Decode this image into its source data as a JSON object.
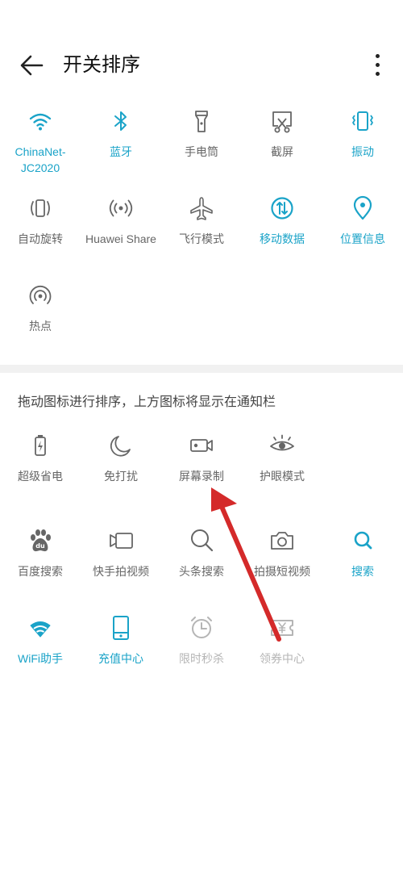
{
  "header": {
    "title": "开关排序"
  },
  "colors": {
    "accent": "#1aa3c8",
    "inactive": "#666666",
    "disabled": "#b5b5b5",
    "arrow": "#d42a2a"
  },
  "active_items": [
    {
      "label": "ChinaNet-\nJC2020",
      "icon": "wifi-icon",
      "state": "on"
    },
    {
      "label": "蓝牙",
      "icon": "bluetooth-icon",
      "state": "on"
    },
    {
      "label": "手电筒",
      "icon": "flashlight-icon",
      "state": "off"
    },
    {
      "label": "截屏",
      "icon": "screenshot-icon",
      "state": "off"
    },
    {
      "label": "振动",
      "icon": "vibrate-icon",
      "state": "on"
    },
    {
      "label": "自动旋转",
      "icon": "auto-rotate-icon",
      "state": "off"
    },
    {
      "label": "Huawei Share",
      "icon": "huawei-share-icon",
      "state": "off"
    },
    {
      "label": "飞行模式",
      "icon": "airplane-icon",
      "state": "off"
    },
    {
      "label": "移动数据",
      "icon": "mobile-data-icon",
      "state": "on"
    },
    {
      "label": "位置信息",
      "icon": "location-icon",
      "state": "on"
    },
    {
      "label": "热点",
      "icon": "hotspot-icon",
      "state": "off"
    }
  ],
  "hint": "拖动图标进行排序，上方图标将显示在通知栏",
  "inactive_items": [
    {
      "label": "超级省电",
      "icon": "battery-saver-icon",
      "state": "off"
    },
    {
      "label": "免打扰",
      "icon": "moon-icon",
      "state": "off"
    },
    {
      "label": "屏幕录制",
      "icon": "screen-record-icon",
      "state": "off"
    },
    {
      "label": "护眼模式",
      "icon": "eye-icon",
      "state": "off"
    },
    {
      "label": "百度搜索",
      "icon": "baidu-icon",
      "state": "off"
    },
    {
      "label": "快手拍视频",
      "icon": "video-camera-icon",
      "state": "off"
    },
    {
      "label": "头条搜索",
      "icon": "search-icon",
      "state": "off"
    },
    {
      "label": "拍摄短视频",
      "icon": "camera-icon",
      "state": "off"
    },
    {
      "label": "搜索",
      "icon": "search-icon",
      "state": "on"
    },
    {
      "label": "WiFi助手",
      "icon": "wifi-assistant-icon",
      "state": "on"
    },
    {
      "label": "充值中心",
      "icon": "phone-recharge-icon",
      "state": "on"
    },
    {
      "label": "限时秒杀",
      "icon": "alarm-clock-icon",
      "state": "disabled"
    },
    {
      "label": "领券中心",
      "icon": "coupon-icon",
      "state": "disabled"
    }
  ]
}
